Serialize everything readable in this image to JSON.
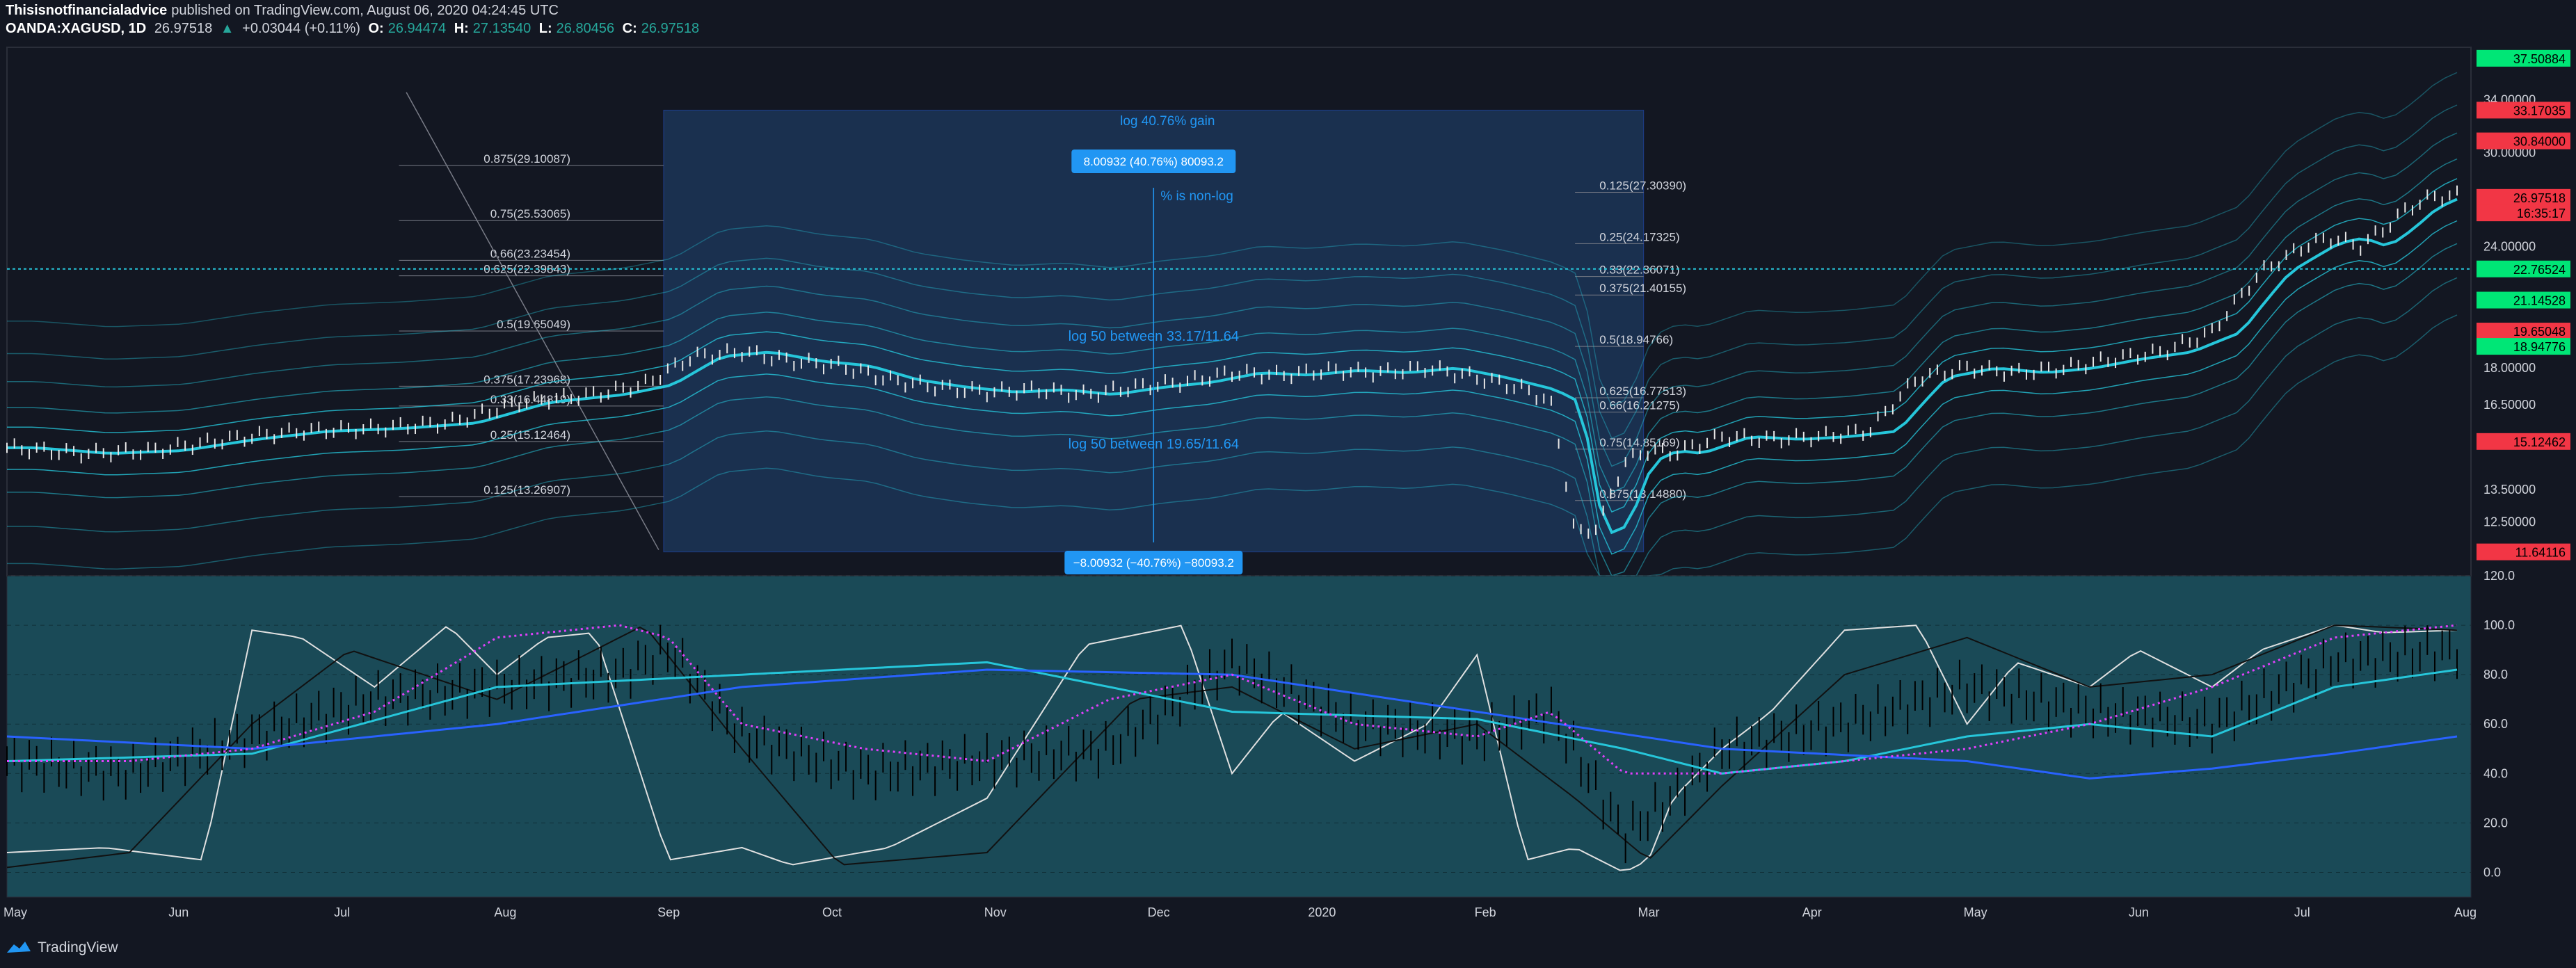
{
  "header": {
    "publisher": "Thisisnotfinancialadvice",
    "published_text": "published on TradingView.com, August 06, 2020 04:24:45 UTC",
    "symbol": "OANDA:XAGUSD, 1D",
    "last": "26.97518",
    "change": "+0.03044 (+0.11%)",
    "o_label": "O:",
    "o": "26.94474",
    "h_label": "H:",
    "h": "27.13540",
    "l_label": "L:",
    "l": "26.80456",
    "c_label": "C:",
    "c": "26.97518"
  },
  "footer": {
    "brand": "TradingView"
  },
  "colors": {
    "background": "#131722",
    "ribbon": "#26c6da",
    "oscillator_bg": "#1a4a57",
    "measure_box": "#1e3a5f",
    "up_price_tag": "#00e676",
    "down_price_tag": "#f23645",
    "blue_tag": "#2196f3",
    "magenta_dots": "#e040fb"
  },
  "chart_data": [
    {
      "type": "line",
      "name": "price",
      "scale": "log",
      "ylim": [
        11.0,
        38.5
      ],
      "x": [
        "May",
        "Jun",
        "Jul",
        "Aug",
        "Sep",
        "Oct",
        "Nov",
        "Dec",
        "2020",
        "Feb",
        "Mar",
        "Apr",
        "May",
        "Jun",
        "Jul",
        "Aug"
      ],
      "y_ticks": [
        "34.00000",
        "30.00000",
        "24.00000",
        "18.00000",
        "16.50000",
        "13.50000",
        "12.50000"
      ],
      "price_tags": [
        {
          "label": "37.50884",
          "color": "#00e676"
        },
        {
          "label": "33.17035",
          "color": "#f23645"
        },
        {
          "label": "30.84000",
          "color": "#f23645"
        },
        {
          "label": "26.97518",
          "color": "#f23645"
        },
        {
          "label": "16:35:17",
          "color": "#f23645"
        },
        {
          "label": "22.76524",
          "color": "#00e676"
        },
        {
          "label": "21.14528",
          "color": "#00e676"
        },
        {
          "label": "19.65048",
          "color": "#f23645"
        },
        {
          "label": "18.94776",
          "color": "#00e676"
        },
        {
          "label": "15.12462",
          "color": "#f23645"
        },
        {
          "label": "11.64116",
          "color": "#f23645"
        }
      ],
      "fib_left": [
        "0.875(29.10087)",
        "0.75(25.53065)",
        "0.66(23.23454)",
        "0.625(22.39843)",
        "0.5(19.65049)",
        "0.375(17.23968)",
        "0.33(16.44819)",
        "0.25(15.12464)",
        "0.125(13.26907)"
      ],
      "fib_right": [
        "0.125(27.30390)",
        "0.25(24.17325)",
        "0.33(22.36071)",
        "0.375(21.40155)",
        "0.5(18.94766)",
        "0.625(16.77513)",
        "0.66(16.21275)",
        "0.75(14.85169)",
        "0.875(13.14880)"
      ],
      "annotations": {
        "log_gain": "log 40.76% gain",
        "measure_up": "8.00932 (40.76%) 80093.2",
        "measure_down": "−8.00932 (−40.76%) −80093.2",
        "non_log": "% is non-log",
        "log50_upper": "log 50 between 33.17/11.64",
        "log50_lower": "log 50 between 19.65/11.64"
      },
      "series": [
        {
          "name": "XAGUSD",
          "t": [
            0,
            0.03,
            0.06,
            0.09,
            0.12,
            0.15,
            0.18,
            0.21,
            0.24,
            0.26,
            0.28,
            0.3,
            0.32,
            0.34,
            0.36,
            0.38,
            0.4,
            0.42,
            0.44,
            0.46,
            0.48,
            0.5,
            0.52,
            0.54,
            0.56,
            0.58,
            0.6,
            0.62,
            0.63,
            0.64,
            0.65,
            0.66,
            0.67,
            0.68,
            0.7,
            0.72,
            0.74,
            0.76,
            0.78,
            0.8,
            0.82,
            0.84,
            0.86,
            0.88,
            0.9,
            0.92,
            0.94,
            0.95,
            0.96,
            0.97,
            0.98,
            0.99,
            1.0
          ],
          "y": [
            14.9,
            14.7,
            14.8,
            15.2,
            15.5,
            15.6,
            15.8,
            16.6,
            16.9,
            17.3,
            18.5,
            18.7,
            18.3,
            18.1,
            17.5,
            17.2,
            17.0,
            17.1,
            16.9,
            17.2,
            17.4,
            17.8,
            17.7,
            17.9,
            17.8,
            18.0,
            17.6,
            17.1,
            16.6,
            12.1,
            12.4,
            14.4,
            14.8,
            14.7,
            15.3,
            15.2,
            15.3,
            15.5,
            17.6,
            18.0,
            17.8,
            18.0,
            18.4,
            18.7,
            19.6,
            22.6,
            24.2,
            24.5,
            24.0,
            25.0,
            26.3,
            27.0,
            27.1
          ]
        }
      ]
    },
    {
      "type": "line",
      "name": "stochastic-rsi-oscillator",
      "ylim": [
        -10,
        120
      ],
      "y_ticks": [
        "120.0",
        "100.0",
        "80.0",
        "60.0",
        "40.0",
        "20.0",
        "0.0"
      ],
      "series": [
        {
          "name": "K",
          "t": [
            0,
            0.04,
            0.08,
            0.1,
            0.12,
            0.15,
            0.18,
            0.2,
            0.22,
            0.24,
            0.27,
            0.3,
            0.32,
            0.36,
            0.4,
            0.44,
            0.48,
            0.5,
            0.52,
            0.55,
            0.58,
            0.6,
            0.62,
            0.64,
            0.66,
            0.67,
            0.68,
            0.7,
            0.72,
            0.75,
            0.78,
            0.8,
            0.82,
            0.85,
            0.87,
            0.9,
            0.92,
            0.95,
            0.97,
            1.0
          ],
          "y": [
            8,
            10,
            5,
            98,
            95,
            75,
            100,
            80,
            95,
            97,
            5,
            10,
            3,
            10,
            30,
            92,
            100,
            40,
            65,
            45,
            60,
            88,
            5,
            10,
            0,
            5,
            30,
            50,
            65,
            98,
            100,
            60,
            85,
            75,
            90,
            75,
            90,
            100,
            97,
            98
          ]
        },
        {
          "name": "D",
          "t": [
            0,
            0.05,
            0.1,
            0.14,
            0.2,
            0.26,
            0.3,
            0.34,
            0.4,
            0.46,
            0.5,
            0.55,
            0.6,
            0.64,
            0.67,
            0.7,
            0.75,
            0.8,
            0.85,
            0.9,
            0.95,
            1.0
          ],
          "y": [
            2,
            8,
            60,
            90,
            70,
            100,
            50,
            3,
            8,
            70,
            75,
            50,
            60,
            30,
            5,
            35,
            80,
            95,
            75,
            80,
            100,
            98
          ]
        },
        {
          "name": "Price-Oscillator",
          "t": [
            0,
            0.05,
            0.1,
            0.15,
            0.2,
            0.25,
            0.27,
            0.3,
            0.35,
            0.4,
            0.45,
            0.5,
            0.55,
            0.6,
            0.63,
            0.66,
            0.68,
            0.7,
            0.75,
            0.8,
            0.85,
            0.9,
            0.95,
            1.0
          ],
          "y": [
            45,
            40,
            55,
            70,
            75,
            80,
            90,
            55,
            40,
            45,
            50,
            85,
            60,
            55,
            65,
            15,
            30,
            50,
            60,
            75,
            65,
            60,
            85,
            90
          ]
        },
        {
          "name": "MA-fast",
          "t": [
            0,
            0.1,
            0.2,
            0.3,
            0.4,
            0.5,
            0.6,
            0.66,
            0.7,
            0.75,
            0.8,
            0.85,
            0.9,
            0.95,
            1.0
          ],
          "y": [
            45,
            48,
            75,
            80,
            85,
            65,
            62,
            50,
            40,
            45,
            55,
            60,
            55,
            75,
            82
          ]
        },
        {
          "name": "MA-slow",
          "t": [
            0,
            0.1,
            0.2,
            0.3,
            0.4,
            0.5,
            0.6,
            0.7,
            0.8,
            0.85,
            0.9,
            0.95,
            1.0
          ],
          "y": [
            55,
            50,
            60,
            75,
            82,
            80,
            65,
            50,
            45,
            38,
            42,
            48,
            55
          ]
        },
        {
          "name": "Magenta-dots",
          "t": [
            0,
            0.05,
            0.1,
            0.15,
            0.2,
            0.25,
            0.27,
            0.3,
            0.35,
            0.4,
            0.45,
            0.5,
            0.55,
            0.6,
            0.63,
            0.66,
            0.7,
            0.75,
            0.8,
            0.85,
            0.9,
            0.95,
            1.0
          ],
          "y": [
            45,
            45,
            50,
            65,
            95,
            100,
            95,
            60,
            50,
            45,
            70,
            80,
            60,
            55,
            65,
            40,
            40,
            45,
            50,
            60,
            75,
            95,
            100
          ]
        }
      ]
    }
  ]
}
